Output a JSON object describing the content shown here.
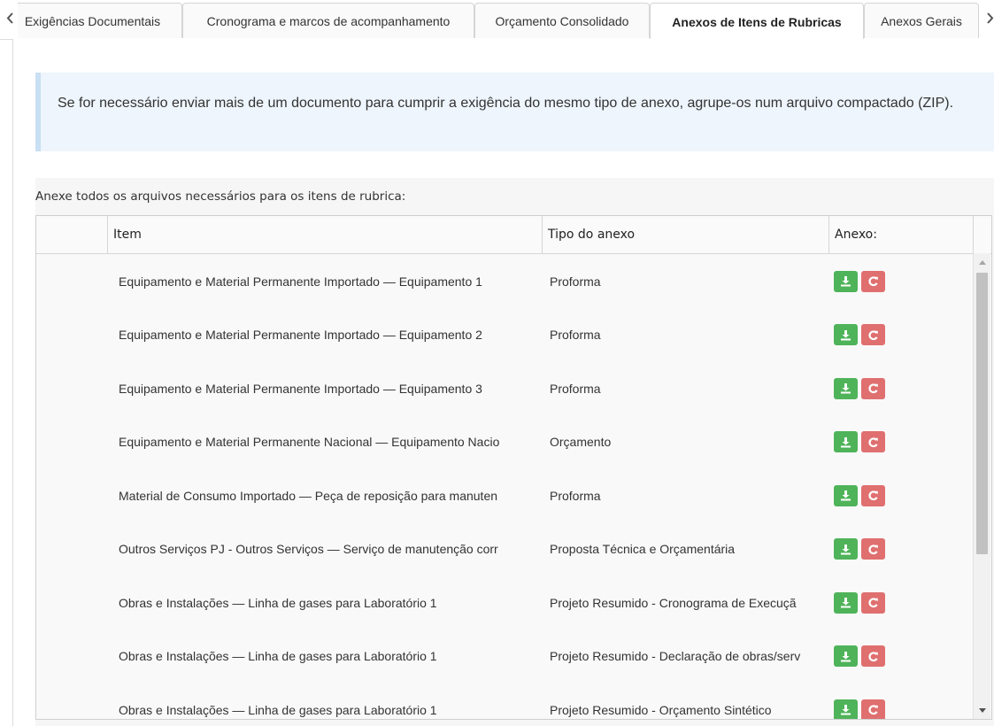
{
  "tabs": [
    {
      "label": "Exigências Documentais",
      "active": false
    },
    {
      "label": "Cronograma e marcos de acompanhamento",
      "active": false
    },
    {
      "label": "Orçamento Consolidado",
      "active": false
    },
    {
      "label": "Anexos de Itens de Rubricas",
      "active": true
    },
    {
      "label": "Anexos Gerais",
      "active": false
    }
  ],
  "alert": {
    "text": "Se for necessário enviar mais de um documento para cumprir a exigência do mesmo tipo de anexo, agrupe-os num arquivo compactado (ZIP)."
  },
  "section": {
    "title": "Anexe todos os arquivos necessários para os itens de rubrica:"
  },
  "grid": {
    "columns": {
      "item": "Item",
      "tipo": "Tipo do anexo",
      "anexo": "Anexo:"
    },
    "rows": [
      {
        "item": "Equipamento e Material Permanente Importado — Equipamento 1",
        "tipo": "Proforma"
      },
      {
        "item": "Equipamento e Material Permanente Importado — Equipamento 2",
        "tipo": "Proforma"
      },
      {
        "item": "Equipamento e Material Permanente Importado — Equipamento 3",
        "tipo": "Proforma"
      },
      {
        "item": "Equipamento e Material Permanente Nacional — Equipamento Nacio",
        "tipo": "Orçamento"
      },
      {
        "item": "Material de Consumo Importado — Peça de reposição para manuten",
        "tipo": "Proforma"
      },
      {
        "item": "Outros Serviços PJ - Outros Serviços — Serviço de manutenção corr",
        "tipo": "Proposta Técnica e Orçamentária"
      },
      {
        "item": "Obras e Instalações — Linha de gases para Laboratório 1",
        "tipo": "Projeto Resumido - Cronograma de Execuçã"
      },
      {
        "item": "Obras e Instalações — Linha de gases para Laboratório 1",
        "tipo": "Projeto Resumido - Declaração de obras/serv"
      },
      {
        "item": "Obras e Instalações — Linha de gases para Laboratório 1",
        "tipo": "Projeto Resumido - Orçamento Sintético"
      }
    ]
  },
  "icons": {
    "download": "download-icon",
    "remove": "refresh-remove-icon",
    "tab_prev": "chevron-left-icon",
    "tab_next": "chevron-right-icon"
  },
  "colors": {
    "download_button": "#4fb35a",
    "remove_button": "#e06f6f",
    "alert_background": "#eef5fc"
  }
}
